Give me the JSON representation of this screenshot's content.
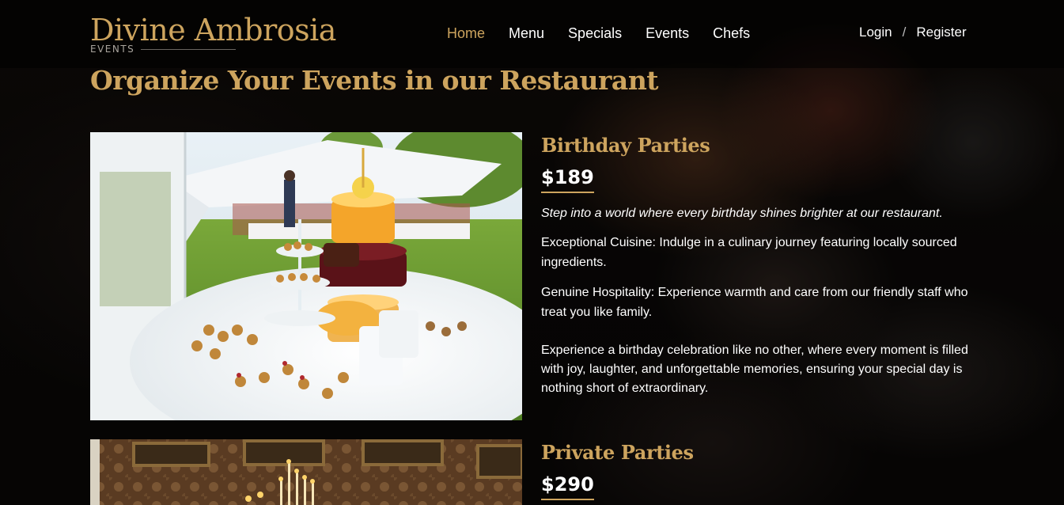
{
  "brand": {
    "name": "Divine Ambrosia",
    "tagline": "EVENTS"
  },
  "nav": {
    "items": [
      "Home",
      "Menu",
      "Specials",
      "Events",
      "Chefs"
    ],
    "active": "Home"
  },
  "auth": {
    "login": "Login",
    "separator": "/",
    "register": "Register"
  },
  "page": {
    "title": "Organize Your Events in our Restaurant"
  },
  "events": [
    {
      "title": "Birthday Parties",
      "price": "$189",
      "intro": "Step into a world where every birthday shines brighter at our restaurant.",
      "features": [
        " Exceptional Cuisine: Indulge in a culinary journey featuring locally sourced ingredients.",
        " Genuine Hospitality: Experience warmth and care from our friendly staff who treat you like family."
      ],
      "description": "Experience a birthday celebration like no other, where every moment is filled with joy, laughter, and unforgettable memories, ensuring your special day is nothing short of extraordinary."
    },
    {
      "title": "Private Parties",
      "price": "$290"
    }
  ],
  "colors": {
    "accent": "#cda45e",
    "text": "#ffffff",
    "header_bg": "rgba(0,0,0,0.55)"
  }
}
